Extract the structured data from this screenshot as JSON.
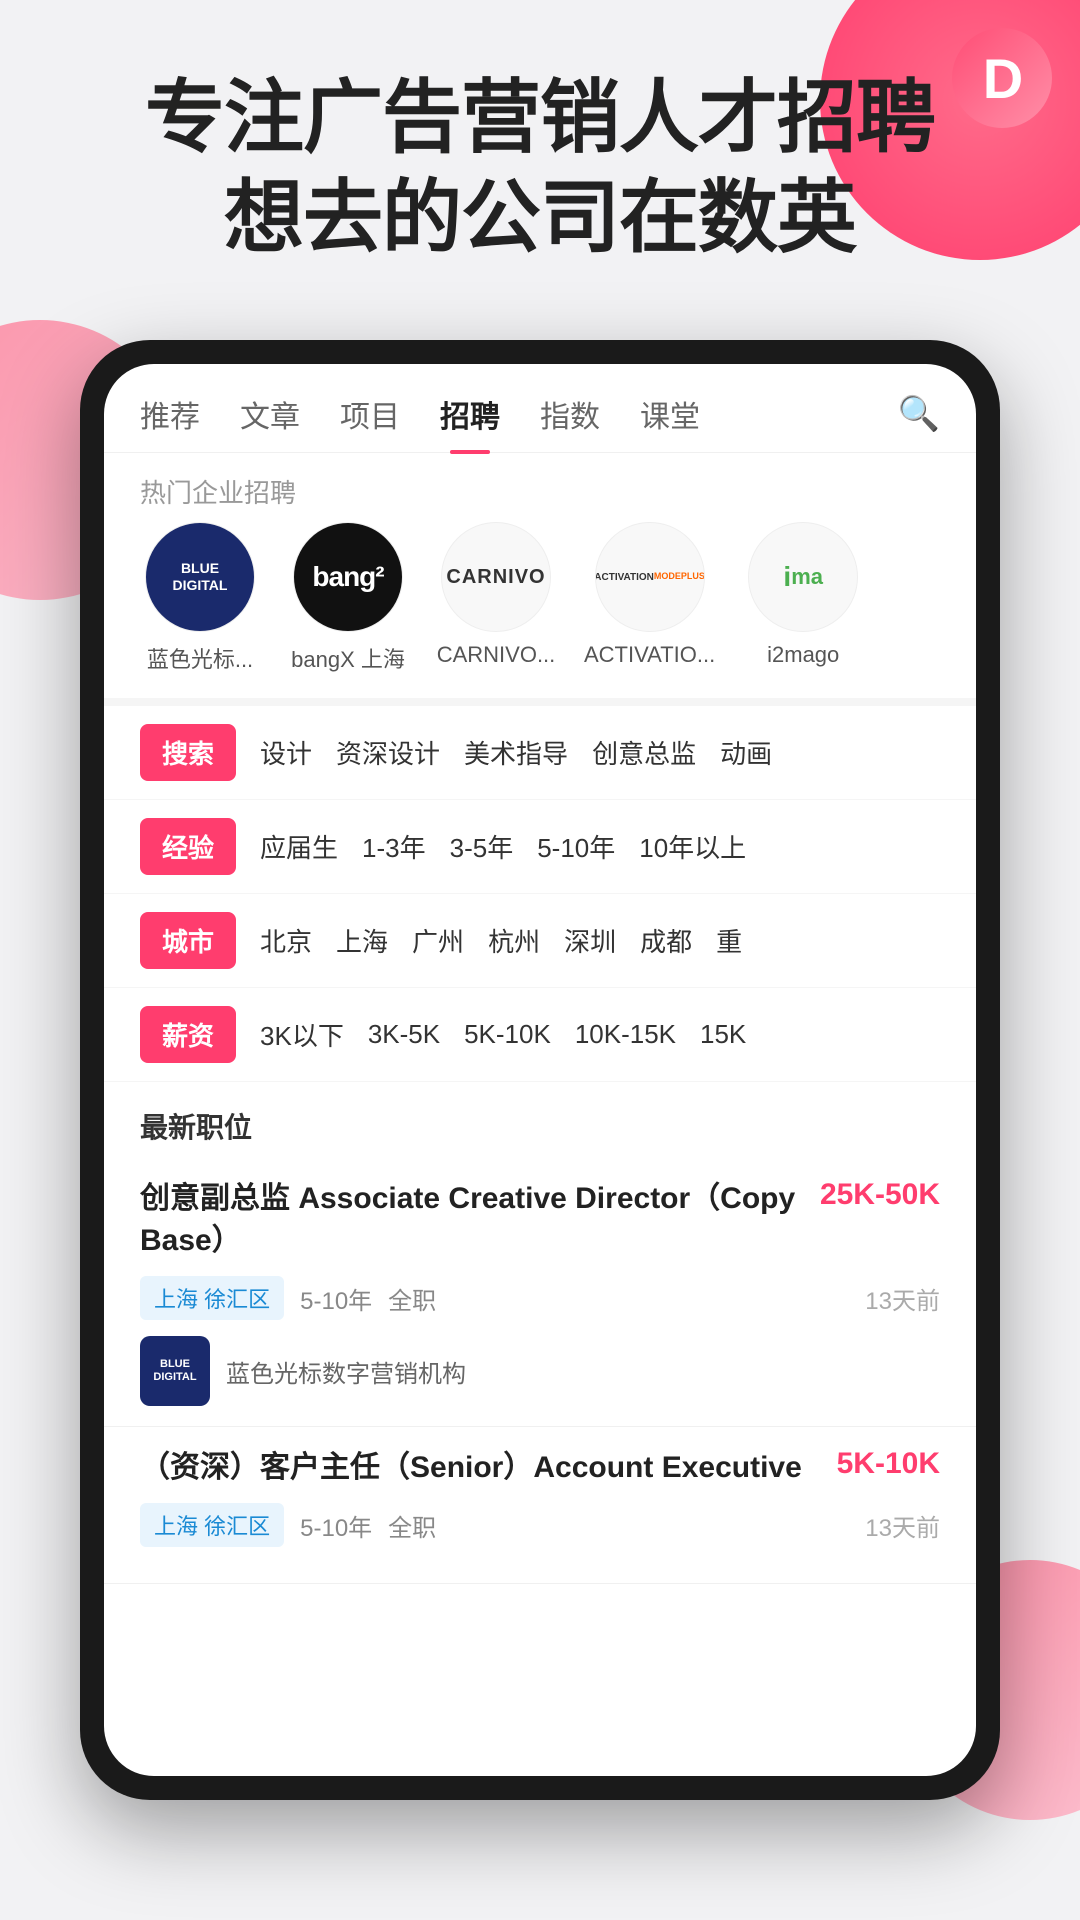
{
  "app": {
    "logo_letter": "D",
    "hero_line1": "专注广告营销人才招聘",
    "hero_line2": "想去的公司在数英"
  },
  "nav": {
    "items": [
      {
        "id": "recommend",
        "label": "推荐",
        "active": false
      },
      {
        "id": "article",
        "label": "文章",
        "active": false
      },
      {
        "id": "project",
        "label": "项目",
        "active": false
      },
      {
        "id": "recruit",
        "label": "招聘",
        "active": true
      },
      {
        "id": "index",
        "label": "指数",
        "active": false
      },
      {
        "id": "class",
        "label": "课堂",
        "active": false
      }
    ],
    "search_icon": "search"
  },
  "hot_companies": {
    "section_label": "热门企业招聘",
    "items": [
      {
        "id": "blue_digital",
        "name": "蓝色光标...",
        "logo_text": "BLUE\nDIGITAL"
      },
      {
        "id": "bangx",
        "name": "bangX 上海",
        "logo_text": "bang²"
      },
      {
        "id": "carnivo",
        "name": "CARNIVO...",
        "logo_text": "CARNIVO"
      },
      {
        "id": "activation",
        "name": "ACTIVATIO...",
        "logo_text": "ACTIVATION\nMODEPLUS"
      },
      {
        "id": "i2mago",
        "name": "i2mago",
        "logo_text": "ima"
      }
    ]
  },
  "filters": [
    {
      "tag": "搜索",
      "options": [
        "设计",
        "资深设计",
        "美术指导",
        "创意总监",
        "动画"
      ]
    },
    {
      "tag": "经验",
      "options": [
        "应届生",
        "1-3年",
        "3-5年",
        "5-10年",
        "10年以上"
      ]
    },
    {
      "tag": "城市",
      "options": [
        "北京",
        "上海",
        "广州",
        "杭州",
        "深圳",
        "成都",
        "重"
      ]
    },
    {
      "tag": "薪资",
      "options": [
        "3K以下",
        "3K-5K",
        "5K-10K",
        "10K-15K",
        "15K"
      ]
    }
  ],
  "jobs": {
    "section_title": "最新职位",
    "items": [
      {
        "title": "创意副总监 Associate Creative Director（Copy Base）",
        "salary": "25K-50K",
        "location": "上海 徐汇区",
        "experience": "5-10年",
        "type": "全职",
        "posted": "13天前",
        "company_name": "蓝色光标数字营销机构",
        "company_logo": "BLUE\nDIGITAL"
      },
      {
        "title": "（资深）客户主任（Senior）Account Executive",
        "salary": "5K-10K",
        "location": "上海 徐汇区",
        "experience": "5-10年",
        "type": "全职",
        "posted": "13天前",
        "company_name": "",
        "company_logo": ""
      }
    ]
  }
}
